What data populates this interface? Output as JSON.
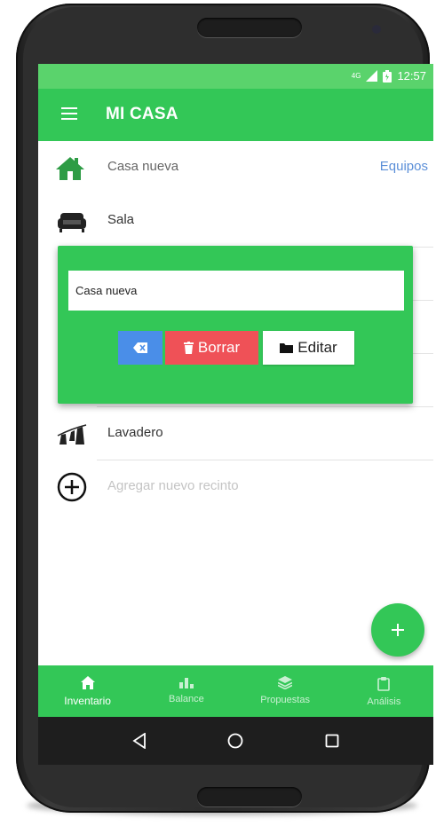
{
  "status_bar": {
    "time": "12:57",
    "network": "4G"
  },
  "app_bar": {
    "title": "MI CASA"
  },
  "list": {
    "header_row": {
      "label": "Casa nueva",
      "link": "Equipos"
    },
    "rooms": [
      {
        "label": "Sala",
        "icon": "sofa-icon"
      },
      {
        "label": "Lavadero",
        "icon": "laundry-icon"
      }
    ],
    "add_room": {
      "label": "Agregar nuevo recinto"
    }
  },
  "dialog": {
    "input_value": "Casa nueva",
    "delete_label": "Borrar",
    "edit_label": "Editar"
  },
  "bottom_nav": [
    {
      "label": "Inventario",
      "icon": "home-icon",
      "active": true
    },
    {
      "label": "Balance",
      "icon": "bar-chart-icon",
      "active": false
    },
    {
      "label": "Propuestas",
      "icon": "layers-icon",
      "active": false
    },
    {
      "label": "Análisis",
      "icon": "clipboard-icon",
      "active": false
    }
  ],
  "colors": {
    "primary": "#33c757",
    "status_bar": "#5ad36c",
    "delete": "#ef5157",
    "clear": "#4a8ee8",
    "link": "#5b8fd8"
  }
}
